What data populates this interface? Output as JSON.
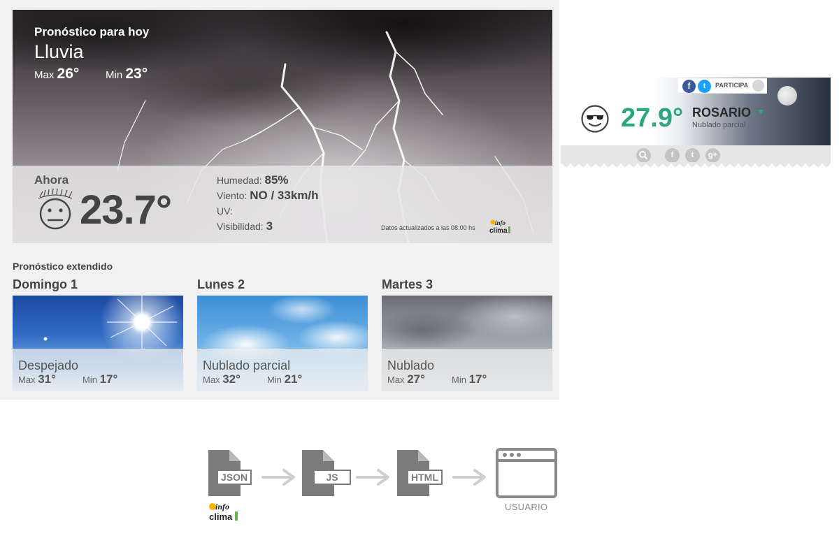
{
  "forecast_today": {
    "title": "Pronóstico para hoy",
    "condition": "Lluvia",
    "max_label": "Max",
    "max_value": "26°",
    "min_label": "Min",
    "min_value": "23°"
  },
  "now": {
    "label": "Ahora",
    "temperature": "23.7°",
    "humidity_label": "Humedad:",
    "humidity_value": "85%",
    "wind_label": "Viento:",
    "wind_value": "NO / 33km/h",
    "uv_label": "UV:",
    "uv_value": "",
    "visibility_label": "Visibilidad:",
    "visibility_value": "3",
    "updated_text": "Datos actualizados a las 08:00 hs"
  },
  "extended": {
    "title": "Pronóstico extendido",
    "days": [
      {
        "name": "Domingo 1",
        "condition": "Despejado",
        "max_label": "Max",
        "max_value": "31°",
        "min_label": "Min",
        "min_value": "17°"
      },
      {
        "name": "Lunes 2",
        "condition": "Nublado parcial",
        "max_label": "Max",
        "max_value": "32°",
        "min_label": "Min",
        "min_value": "21°"
      },
      {
        "name": "Martes 3",
        "condition": "Nublado",
        "max_label": "Max",
        "max_value": "27°",
        "min_label": "Min",
        "min_value": "17°"
      }
    ]
  },
  "mini_widget": {
    "participa_label": "PARTICIPA",
    "temperature": "27.9°",
    "city": "ROSARIO",
    "condition": "Nublado parcial",
    "temp_color": "#2aa77f"
  },
  "logo": {
    "line1": "info",
    "line2": "clima"
  },
  "flow": {
    "steps": [
      "JSON",
      "JS",
      "HTML"
    ],
    "end_label": "USUARIO"
  },
  "icons": [
    "neutral-face-icon",
    "sunglasses-face-icon",
    "facebook-icon",
    "twitter-icon",
    "user-icon",
    "search-icon",
    "googleplus-icon",
    "file-icon",
    "arrow-right-icon",
    "browser-window-icon",
    "infoclima-logo"
  ]
}
